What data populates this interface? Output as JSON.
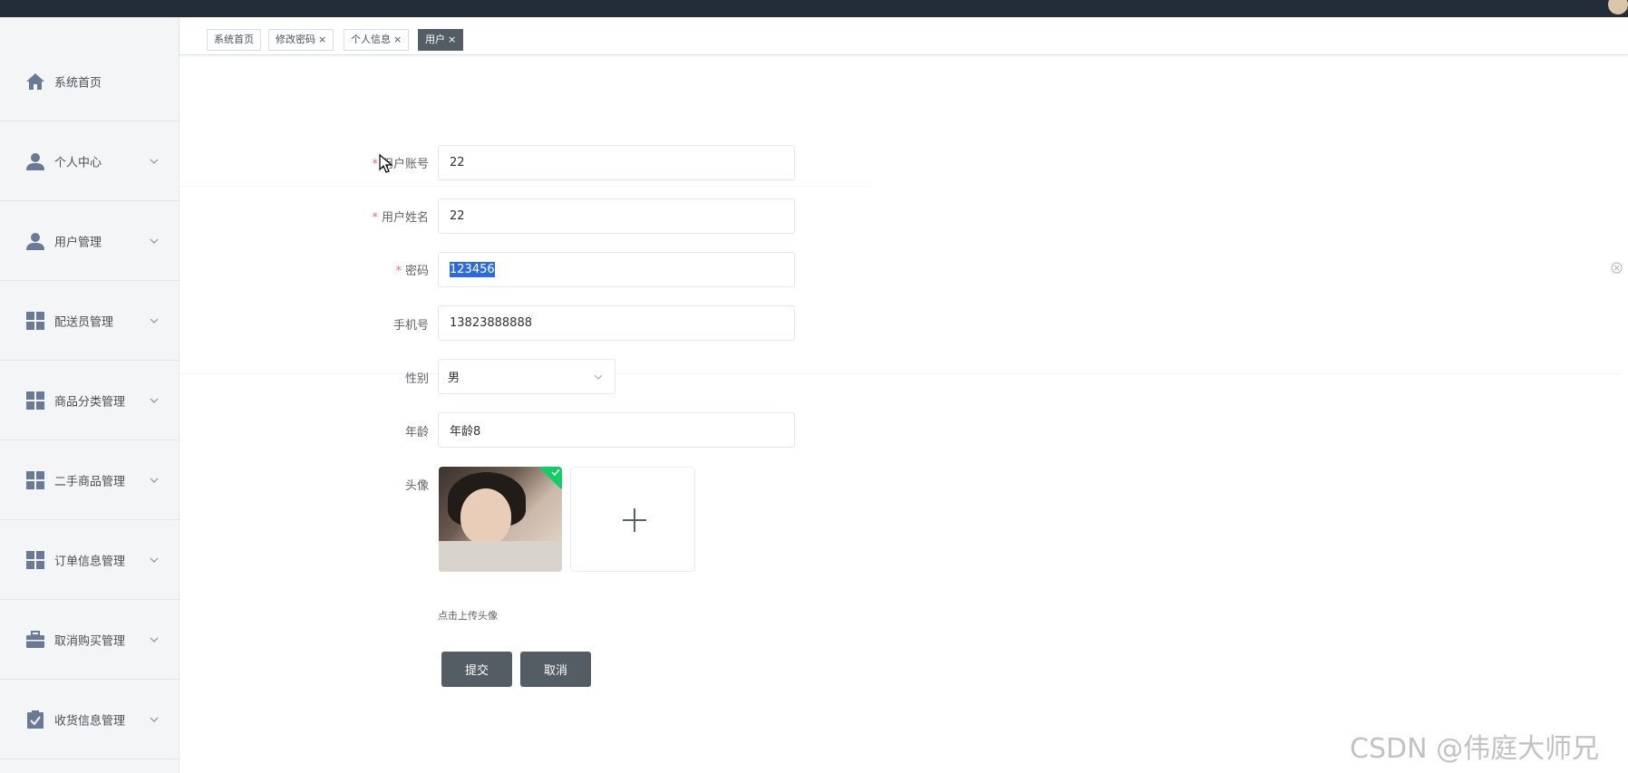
{
  "sidebar": {
    "items": [
      {
        "label": "系统首页",
        "icon": "home-icon",
        "has_arrow": false
      },
      {
        "label": "个人中心",
        "icon": "user-icon",
        "has_arrow": true
      },
      {
        "label": "用户管理",
        "icon": "user-icon",
        "has_arrow": true
      },
      {
        "label": "配送员管理",
        "icon": "grid-icon",
        "has_arrow": true
      },
      {
        "label": "商品分类管理",
        "icon": "grid-icon",
        "has_arrow": true
      },
      {
        "label": "二手商品管理",
        "icon": "grid-icon",
        "has_arrow": true
      },
      {
        "label": "订单信息管理",
        "icon": "grid-icon",
        "has_arrow": true
      },
      {
        "label": "取消购买管理",
        "icon": "briefcase-icon",
        "has_arrow": true
      },
      {
        "label": "收货信息管理",
        "icon": "clipboard-check-icon",
        "has_arrow": true
      }
    ]
  },
  "tabs": [
    {
      "label": "系统首页",
      "closable": false,
      "active": false
    },
    {
      "label": "修改密码",
      "closable": true,
      "active": false
    },
    {
      "label": "个人信息",
      "closable": true,
      "active": false
    },
    {
      "label": "用户",
      "closable": true,
      "active": true
    }
  ],
  "tab_close_glyph": "×",
  "form": {
    "account": {
      "label": "用户账号",
      "value": "22",
      "required": true
    },
    "name": {
      "label": "用户姓名",
      "value": "22",
      "required": true
    },
    "password": {
      "label": "密码",
      "value": "123456",
      "required": true
    },
    "phone": {
      "label": "手机号",
      "value": "13823888888",
      "required": false
    },
    "gender": {
      "label": "性别",
      "value": "男",
      "required": false
    },
    "age": {
      "label": "年龄",
      "value": "年龄8",
      "required": false
    },
    "avatar": {
      "label": "头像",
      "tip": "点击上传头像"
    },
    "required_mark": "*",
    "submit_label": "提交",
    "cancel_label": "取消"
  },
  "watermark": "CSDN @伟庭大师兄",
  "colors": {
    "topbar": "#232d3a",
    "sidebar_bg": "#f4f5f7",
    "button": "#545c64",
    "required": "#f56c6c",
    "upload_success": "#13ce66",
    "selection": "#2f6bd8"
  }
}
